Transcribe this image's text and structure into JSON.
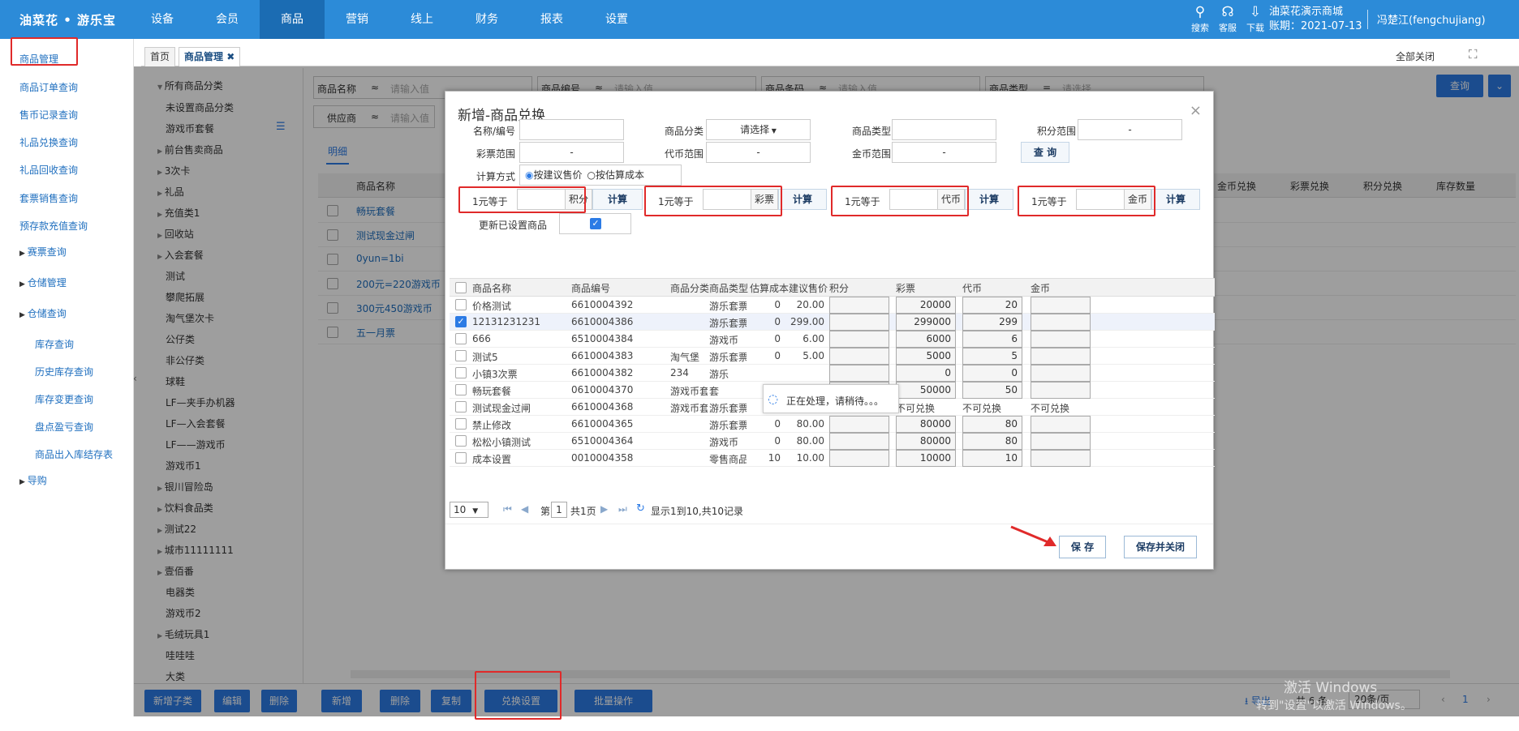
{
  "topbar": {
    "logo": "油菜花 • 游乐宝",
    "nav": [
      "设备",
      "会员",
      "商品",
      "营销",
      "线上",
      "财务",
      "报表",
      "设置"
    ],
    "icons": [
      {
        "icon": "search-icon",
        "label": "搜索",
        "glyph": "⚲"
      },
      {
        "icon": "headset-icon",
        "label": "客服",
        "glyph": "☊"
      },
      {
        "icon": "download-icon",
        "label": "下载",
        "glyph": "⇩"
      }
    ],
    "store_name": "油菜花演示商城",
    "period": "账期：2021-07-13",
    "user": "冯楚江(fengchujiang)"
  },
  "sidebar": {
    "items": [
      "商品管理",
      "商品订单查询",
      "售币记录查询",
      "礼品兑换查询",
      "礼品回收查询",
      "套票销售查询",
      "预存款充值查询"
    ],
    "groups": [
      "赛票查询",
      "仓储管理",
      "仓储查询"
    ],
    "sub_items": [
      "库存查询",
      "历史库存查询",
      "库存变更查询",
      "盘点盈亏查询",
      "商品出入库结存表"
    ],
    "last_group": "导购"
  },
  "tabs": {
    "home": "首页",
    "current": "商品管理",
    "close_all": "全部关闭"
  },
  "filters": {
    "name_label": "商品名称",
    "code_label": "商品编号",
    "barcode_label": "商品条码",
    "type_label": "商品类型",
    "supplier_label": "供应商",
    "placeholder": "请输入值",
    "select_placeholder": "请选择",
    "query": "查询",
    "detail_tab": "明细"
  },
  "tree": {
    "root": "所有商品分类",
    "nodes": [
      "未设置商品分类",
      "游戏币套餐",
      "前台售卖商品",
      "3次卡",
      "礼品",
      "充值类1",
      "回收站",
      "入会套餐",
      "测试",
      "攀爬拓展",
      "淘气堡次卡",
      "公仔类",
      "非公仔类",
      "球鞋",
      "LF—夹手办机器",
      "LF—入会套餐",
      "LF——游戏币",
      "游戏币1",
      "银川冒险岛",
      "饮料食品类",
      "测试22",
      "城市11111111",
      "壹佰番",
      "电器类",
      "游戏币2",
      "毛绒玩具1",
      "哇哇哇",
      "大类"
    ],
    "expandable": [
      2,
      3,
      4,
      5,
      6,
      7,
      18,
      19,
      20,
      21,
      22,
      25
    ]
  },
  "bg_table": {
    "header_name": "商品名称",
    "rows": [
      "畅玩套餐",
      "测试现金过闸",
      "0yun=1bi",
      "200元=220游戏币",
      "300元450游戏币",
      "五一月票"
    ],
    "right_headers": [
      "金币兑换",
      "彩票兑换",
      "积分兑换",
      "库存数量"
    ]
  },
  "bottom_bar": {
    "left_buttons": [
      "新增子类",
      "编辑",
      "删除"
    ],
    "buttons": [
      "新增",
      "删除",
      "复制",
      "兑换设置",
      "批量操作"
    ],
    "export": "导出",
    "total": "共 6 条",
    "page_size": "20条/页",
    "page": "1"
  },
  "watermark": {
    "line1": "激活 Windows",
    "line2": "转到\"设置\"以激活 Windows。"
  },
  "dialog": {
    "title": "新增-商品兑换",
    "filters": {
      "name_code": "名称/编号",
      "category": "商品分类",
      "category_value": "请选择",
      "type": "商品类型",
      "points_range": "积分范围",
      "lottery_range": "彩票范围",
      "token_range": "代币范围",
      "coin_range": "金币范围",
      "dash": "-",
      "query": "查 询",
      "calc_method": "计算方式",
      "opt1": "按建议售价",
      "opt2": "按估算成本"
    },
    "calc": [
      {
        "prefix": "1元等于",
        "unit": "积分",
        "btn": "计算"
      },
      {
        "prefix": "1元等于",
        "unit": "彩票",
        "btn": "计算"
      },
      {
        "prefix": "1元等于",
        "unit": "代币",
        "btn": "计算"
      },
      {
        "prefix": "1元等于",
        "unit": "金币",
        "btn": "计算"
      }
    ],
    "update_set": "更新已设置商品",
    "columns": [
      "商品名称",
      "商品编号",
      "商品分类",
      "商品类型",
      "估算成本",
      "建议售价",
      "积分",
      "彩票",
      "代币",
      "金币"
    ],
    "rows": [
      {
        "name": "价格测试",
        "code": "6610004392",
        "cat": "",
        "type": "游乐套票",
        "cost": "0",
        "price": "20.00",
        "pts": "",
        "lot": "20000",
        "tok": "20",
        "coin": "",
        "sel": false,
        "nx": false
      },
      {
        "name": "12131231231",
        "code": "6610004386",
        "cat": "",
        "type": "游乐套票",
        "cost": "0",
        "price": "299.00",
        "pts": "",
        "lot": "299000",
        "tok": "299",
        "coin": "",
        "sel": true,
        "nx": false
      },
      {
        "name": "666",
        "code": "6510004384",
        "cat": "",
        "type": "游戏币",
        "cost": "0",
        "price": "6.00",
        "pts": "",
        "lot": "6000",
        "tok": "6",
        "coin": "",
        "sel": false,
        "nx": false
      },
      {
        "name": "测试5",
        "code": "6610004383",
        "cat": "淘气堡",
        "type": "游乐套票",
        "cost": "0",
        "price": "5.00",
        "pts": "",
        "lot": "5000",
        "tok": "5",
        "coin": "",
        "sel": false,
        "nx": false
      },
      {
        "name": "小镇3次票",
        "code": "6610004382",
        "cat": "234",
        "type": "游乐",
        "cost": "",
        "price": "",
        "pts": "",
        "lot": "0",
        "tok": "0",
        "coin": "",
        "sel": false,
        "nx": false
      },
      {
        "name": "畅玩套餐",
        "code": "0610004370",
        "cat": "游戏币套餐",
        "type": "套",
        "cost": "",
        "price": "",
        "pts": "",
        "lot": "50000",
        "tok": "50",
        "coin": "",
        "sel": false,
        "nx": false
      },
      {
        "name": "测试现金过闸",
        "code": "6610004368",
        "cat": "游戏币套餐",
        "type": "游乐套票",
        "cost": "0",
        "price": "10.00",
        "pts": "不可兑换",
        "lot": "不可兑换",
        "tok": "不可兑换",
        "coin": "不可兑换",
        "sel": false,
        "nx": true
      },
      {
        "name": "禁止修改",
        "code": "6610004365",
        "cat": "",
        "type": "游乐套票",
        "cost": "0",
        "price": "80.00",
        "pts": "",
        "lot": "80000",
        "tok": "80",
        "coin": "",
        "sel": false,
        "nx": false
      },
      {
        "name": "松松小镇测试",
        "code": "6510004364",
        "cat": "",
        "type": "游戏币",
        "cost": "0",
        "price": "80.00",
        "pts": "",
        "lot": "80000",
        "tok": "80",
        "coin": "",
        "sel": false,
        "nx": false
      },
      {
        "name": "成本设置",
        "code": "0010004358",
        "cat": "",
        "type": "零售商品",
        "cost": "10",
        "price": "10.00",
        "pts": "",
        "lot": "10000",
        "tok": "10",
        "coin": "",
        "sel": false,
        "nx": false
      }
    ],
    "pager": {
      "size": "10",
      "page_prefix": "第",
      "page": "1",
      "page_total": "共1页",
      "info": "显示1到10,共10记录"
    },
    "loading": "正在处理，请稍待。。。",
    "save": "保 存",
    "save_close": "保存并关闭"
  }
}
